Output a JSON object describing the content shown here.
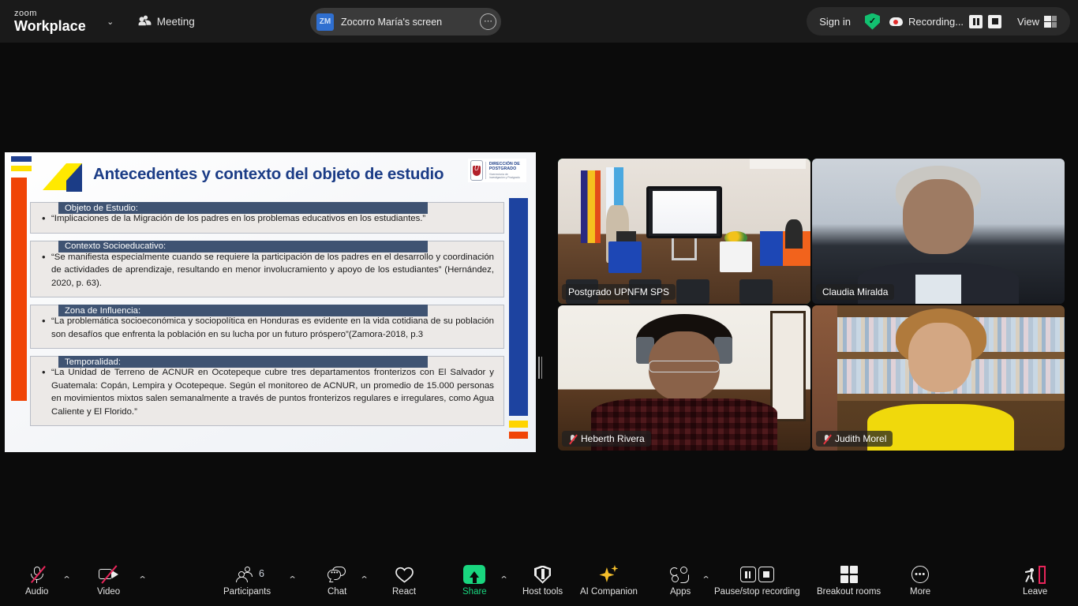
{
  "app": {
    "brand_line1": "zoom",
    "brand_line2": "Workplace",
    "meeting_label": "Meeting",
    "accent_green": "#19d67f",
    "accent_red": "#e8255a"
  },
  "topbar": {
    "brand_caret": "⌄",
    "shared_screen": {
      "badge": "ZM",
      "title": "Zocorro María's screen",
      "more": "⋯"
    },
    "sign_in": "Sign in",
    "encryption_tooltip": "✓",
    "recording_label": "Recording...",
    "view_label": "View"
  },
  "share_slide": {
    "title": "Antecedentes y contexto del objeto de estudio",
    "logo": {
      "line1": "DIRECCIÓN DE",
      "line2": "POSTGRADO",
      "sub": "Vicerrectoría de Investigación y Postgrado"
    },
    "blocks": [
      {
        "heading": "Objeto de Estudio:",
        "bullets": [
          "“Implicaciones de la Migración de los padres en los problemas educativos en los estudiantes.”"
        ]
      },
      {
        "heading": "Contexto Socioeducativo:",
        "bullets": [
          "“Se manifiesta especialmente cuando se requiere la participación de los padres en el desarrollo y coordinación de actividades de aprendizaje, resultando en menor involucramiento y apoyo de los estudiantes” (Hernández, 2020, p. 63)."
        ]
      },
      {
        "heading": "Zona de Influencia:",
        "bullets": [
          "“La problemática socioeconómica y sociopolítica en Honduras es  evidente en la vida cotidiana de su  población son desafíos que enfrenta la población en su lucha por un futuro próspero”(Zamora-2018, p.3"
        ]
      },
      {
        "heading": "Temporalidad:",
        "bullets": [
          "“La Unidad de Terreno de ACNUR en Ocotepeque cubre tres departamentos fronterizos con El Salvador y Guatemala: Copán, Lempira y Ocotepeque. Según el monitoreo de ACNUR, un promedio de 15.000 personas en movimientos mixtos salen semanalmente a través de puntos fronterizos regulares e irregulares, como Agua Caliente y El Florido.”"
        ]
      }
    ]
  },
  "participants": [
    {
      "name": "Postgrado UPNFM SPS",
      "muted": false,
      "speaking": true
    },
    {
      "name": "Claudia Miralda",
      "muted": false,
      "speaking": false
    },
    {
      "name": "Heberth Rivera",
      "muted": true,
      "speaking": false
    },
    {
      "name": "Judith Morel",
      "muted": true,
      "speaking": false
    }
  ],
  "toolbar": {
    "audio": {
      "label": "Audio",
      "caret": "⌃"
    },
    "video": {
      "label": "Video",
      "caret": "⌃"
    },
    "participants": {
      "label": "Participants",
      "count": "6",
      "caret": "⌃"
    },
    "chat": {
      "label": "Chat",
      "caret": "⌃"
    },
    "react": {
      "label": "React"
    },
    "share": {
      "label": "Share",
      "caret": "⌃"
    },
    "host_tools": {
      "label": "Host tools"
    },
    "ai_companion": {
      "label": "AI Companion"
    },
    "apps": {
      "label": "Apps",
      "caret": "⌃"
    },
    "recording": {
      "label": "Pause/stop recording"
    },
    "breakout": {
      "label": "Breakout rooms"
    },
    "more": {
      "label": "More",
      "glyph": "•••"
    },
    "leave": {
      "label": "Leave"
    }
  }
}
